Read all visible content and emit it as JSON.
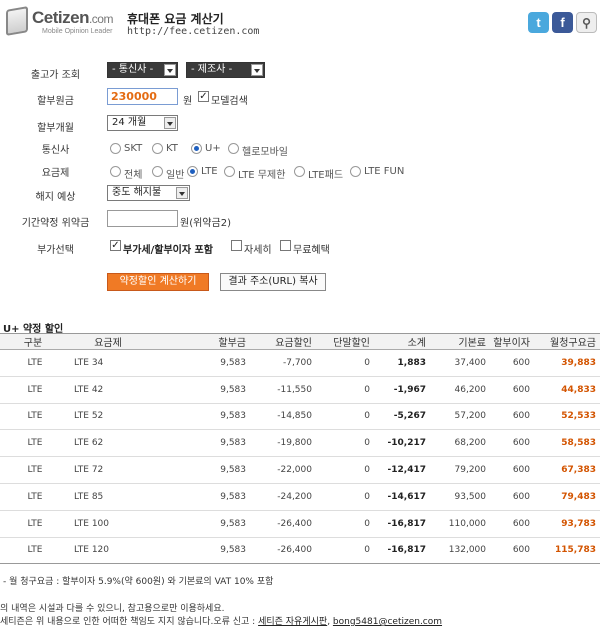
{
  "header": {
    "logo_name": "Cetizen",
    "logo_domain": ".com",
    "logo_tagline": "Mobile Opinion Leader",
    "title": "휴대폰 요금 계산기",
    "url": "http://fee.cetizen.com",
    "social_icons": [
      "twitter-icon",
      "facebook-icon",
      "ms-icon"
    ]
  },
  "form": {
    "factory_price": {
      "label": "출고가 조회",
      "carrier_select": "- 통신사 -",
      "maker_select": "- 제조사 -"
    },
    "installment": {
      "label": "할부원금",
      "value": "230000",
      "unit": "원",
      "model_search": "모델검색",
      "model_search_checked": true
    },
    "months": {
      "label": "할부개월",
      "value": "24 개월"
    },
    "carrier": {
      "label": "통신사",
      "options": [
        "SKT",
        "KT",
        "U+",
        "헬로모바일"
      ],
      "selected": "U+"
    },
    "plan": {
      "label": "요금제",
      "options": [
        "전체",
        "일반",
        "LTE",
        "LTE 무제한",
        "LTE패드",
        "LTE FUN"
      ],
      "selected": "LTE"
    },
    "cancel": {
      "label": "해지 예상",
      "value": "중도 해지불"
    },
    "penalty": {
      "label": "기간약정 위약금",
      "value": "",
      "suffix": "원(위약금2)"
    },
    "extras": {
      "label": "부가선택",
      "vat": "부가세/할부이자 포함",
      "vat_checked": true,
      "detail": "자세히",
      "detail_checked": false,
      "free": "무료혜택",
      "free_checked": false
    },
    "calc_button": "약정할인 계산하기",
    "copy_button": "결과 주소(URL) 복사"
  },
  "result": {
    "title": "U+ 약정 할인",
    "columns": [
      "구분",
      "요금제",
      "할부금",
      "요금할인",
      "단말할인",
      "소계",
      "기본료",
      "할부이자",
      "월청구요금"
    ],
    "rows": [
      [
        "LTE",
        "LTE 34",
        "9,583",
        "-7,700",
        "0",
        "1,883",
        "37,400",
        "600",
        "39,883"
      ],
      [
        "LTE",
        "LTE 42",
        "9,583",
        "-11,550",
        "0",
        "-1,967",
        "46,200",
        "600",
        "44,833"
      ],
      [
        "LTE",
        "LTE 52",
        "9,583",
        "-14,850",
        "0",
        "-5,267",
        "57,200",
        "600",
        "52,533"
      ],
      [
        "LTE",
        "LTE 62",
        "9,583",
        "-19,800",
        "0",
        "-10,217",
        "68,200",
        "600",
        "58,583"
      ],
      [
        "LTE",
        "LTE 72",
        "9,583",
        "-22,000",
        "0",
        "-12,417",
        "79,200",
        "600",
        "67,383"
      ],
      [
        "LTE",
        "LTE 85",
        "9,583",
        "-24,200",
        "0",
        "-14,617",
        "93,500",
        "600",
        "79,483"
      ],
      [
        "LTE",
        "LTE 100",
        "9,583",
        "-26,400",
        "0",
        "-16,817",
        "110,000",
        "600",
        "93,783"
      ],
      [
        "LTE",
        "LTE 120",
        "9,583",
        "-26,400",
        "0",
        "-16,817",
        "132,000",
        "600",
        "115,783"
      ]
    ]
  },
  "footnote": "- 월 청구요금 : 할부이자 5.9%(약 600원) 와 기본료의 VAT 10% 포함",
  "disclaimer1": "의 내역은 시설과 다를 수 있으니, 참고용으로만 이용하세요.",
  "disclaimer2_prefix": "세티즌은 위 내용으로 인한 어떠한 책임도 지지 않습니다.오류 신고 : ",
  "disclaimer2_link": "세티즌 자유게시판",
  "disclaimer2_sep": ", ",
  "disclaimer2_email": "bong5481@cetizen.com"
}
